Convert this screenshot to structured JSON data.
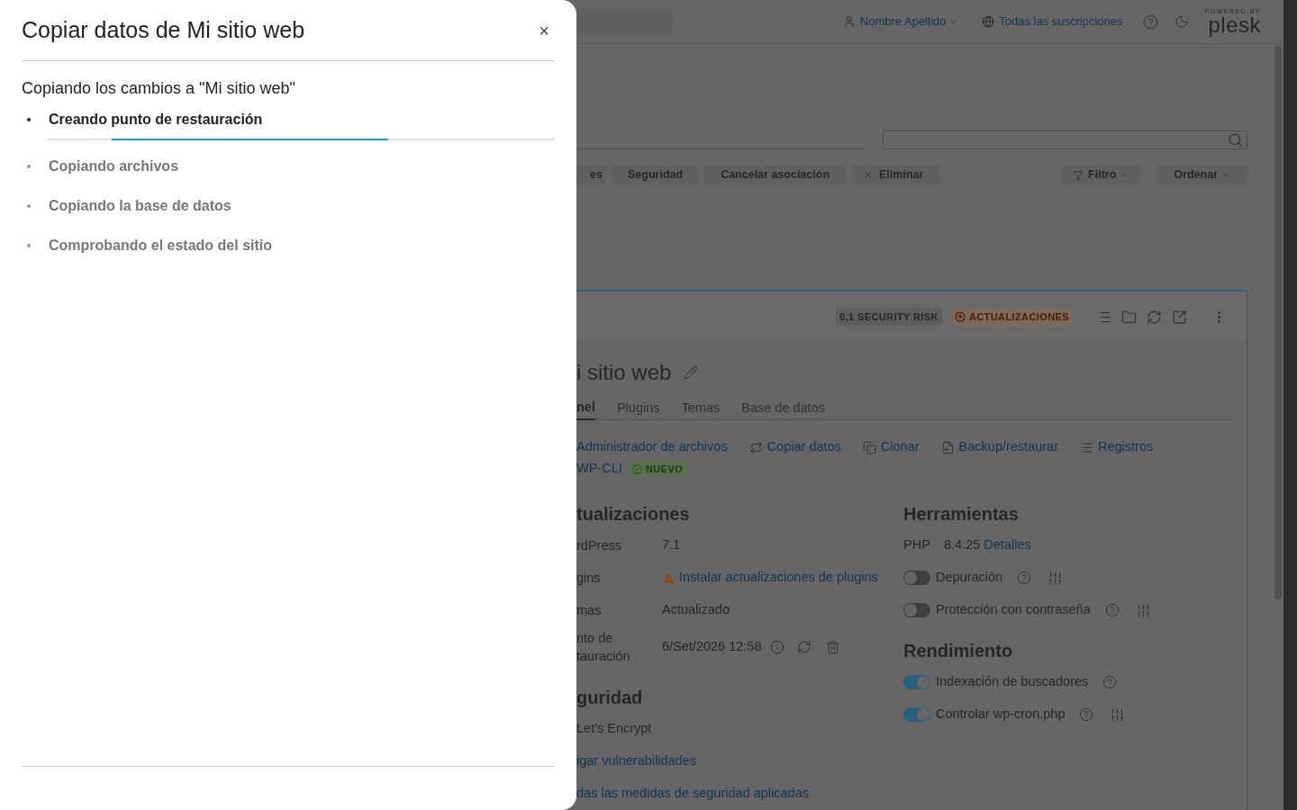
{
  "drawer": {
    "title": "Copiar datos de Mi sitio web",
    "close": "×",
    "heading": "Copiando los cambios a \"Mi sitio web\"",
    "steps": [
      {
        "label": "Creando punto de restauración",
        "active": true
      },
      {
        "label": "Copiando archivos",
        "active": false
      },
      {
        "label": "Copiando la base de datos",
        "active": false
      },
      {
        "label": "Comprobando el estado del sitio",
        "active": false
      }
    ]
  },
  "header": {
    "user": "Nombre Apellido",
    "subscriptions": "Todas las suscripciones",
    "logo_caption": "POWERED BY",
    "logo": "plesk"
  },
  "toolbar": {
    "buttons": [
      {
        "label": "es",
        "kind": "plain"
      },
      {
        "label": "Seguridad",
        "kind": "plain"
      },
      {
        "label": "Cancelar asociación",
        "kind": "plain"
      },
      {
        "label": "Eliminar",
        "kind": "remove"
      }
    ],
    "filter": "Filtro",
    "sort": "Ordenar"
  },
  "site": {
    "badges": [
      {
        "label": "0,1 SECURITY RISK",
        "kind": "neutral"
      },
      {
        "label": "ACTUALIZACIONES",
        "kind": "warning"
      }
    ],
    "title": "i sitio web",
    "tabs": [
      {
        "label": "nel",
        "selected": true
      },
      {
        "label": "Plugins",
        "selected": false
      },
      {
        "label": "Temas",
        "selected": false
      },
      {
        "label": "Base de datos",
        "selected": false
      }
    ],
    "links": [
      {
        "label": "Administrador de archivos",
        "kind": "plain"
      },
      {
        "label": "Copiar datos",
        "kind": "copy"
      },
      {
        "label": "Clonar",
        "kind": "clone"
      },
      {
        "label": "Backup/restaurar",
        "kind": "backup"
      },
      {
        "label": "Registros",
        "kind": "logs"
      }
    ],
    "wpcli": "WP-CLI",
    "new_badge": "NUEVO",
    "updates": {
      "heading": "tualizaciones",
      "rows": [
        {
          "label": "rdPress",
          "value": "7.1",
          "kind": "text"
        },
        {
          "label": "gins",
          "value": "Instalar actualizaciones de plugins",
          "kind": "warning-link"
        },
        {
          "label": "mas",
          "value": "Actualizado",
          "kind": "text"
        },
        {
          "label": "nto de tauración",
          "value": "6/Set/2026 12:58",
          "kind": "restore"
        }
      ]
    },
    "security": {
      "heading": "guridad",
      "items": [
        {
          "label": "Let's Encrypt",
          "kind": "text"
        },
        {
          "label": "igar vulnerabilidades",
          "kind": "link"
        },
        {
          "label": "das las medidas de seguridad aplicadas",
          "kind": "link"
        }
      ]
    },
    "tools": {
      "heading": "Herramientas",
      "php": {
        "label": "PHP",
        "version": "8.4.25",
        "link": "Detalles"
      },
      "toggles": [
        {
          "label": "Depuración",
          "on": false,
          "settings": true
        },
        {
          "label": "Protección con contraseña",
          "on": false,
          "settings": true
        }
      ]
    },
    "performance": {
      "heading": "Rendimiento",
      "toggles": [
        {
          "label": "Indexación de buscadores",
          "on": true,
          "settings": false
        },
        {
          "label": "Controlar wp-cron.php",
          "on": true,
          "settings": true
        }
      ]
    }
  }
}
